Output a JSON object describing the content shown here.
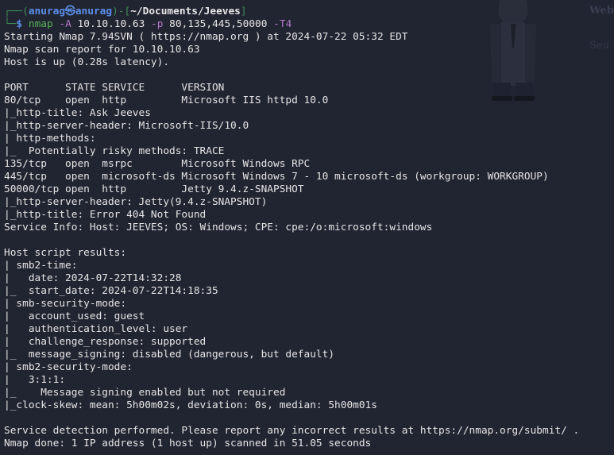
{
  "prompt": {
    "frame_top_left": "┌──(",
    "user_host": "anurag㉿anurag",
    "frame_mid": ")-[",
    "cwd": "~/Documents/Jeeves",
    "frame_end": "]",
    "frame_bottom": "└─",
    "dollar": "$"
  },
  "command": {
    "name": "nmap",
    "flag_A": "-A",
    "target": "10.10.10.63",
    "flag_p": "-p",
    "ports": "80,135,445,50000",
    "flag_T": "-T4"
  },
  "output_lines": [
    "Starting Nmap 7.94SVN ( https://nmap.org ) at 2024-07-22 05:32 EDT",
    "Nmap scan report for 10.10.10.63",
    "Host is up (0.28s latency).",
    "",
    "PORT      STATE SERVICE      VERSION",
    "80/tcp    open  http         Microsoft IIS httpd 10.0",
    "|_http-title: Ask Jeeves",
    "|_http-server-header: Microsoft-IIS/10.0",
    "| http-methods:",
    "|_  Potentially risky methods: TRACE",
    "135/tcp   open  msrpc        Microsoft Windows RPC",
    "445/tcp   open  microsoft-ds Microsoft Windows 7 - 10 microsoft-ds (workgroup: WORKGROUP)",
    "50000/tcp open  http         Jetty 9.4.z-SNAPSHOT",
    "|_http-server-header: Jetty(9.4.z-SNAPSHOT)",
    "|_http-title: Error 404 Not Found",
    "Service Info: Host: JEEVES; OS: Windows; CPE: cpe:/o:microsoft:windows",
    "",
    "Host script results:",
    "| smb2-time:",
    "|   date: 2024-07-22T14:32:28",
    "|_  start_date: 2024-07-22T14:18:35",
    "| smb-security-mode:",
    "|   account_used: guest",
    "|   authentication_level: user",
    "|   challenge_response: supported",
    "|_  message_signing: disabled (dangerous, but default)",
    "| smb2-security-mode:",
    "|   3:1:1:",
    "|_    Message signing enabled but not required",
    "|_clock-skew: mean: 5h00m02s, deviation: 0s, median: 5h00m01s",
    "",
    "Service detection performed. Please report any incorrect results at https://nmap.org/submit/ .",
    "Nmap done: 1 IP address (1 host up) scanned in 51.05 seconds"
  ],
  "background_text": {
    "line1": "Web",
    "line2": "Seu"
  },
  "colors": {
    "terminal_bg": "#212431",
    "text": "#e6e6e6",
    "prompt_user": "#5b8fe8",
    "prompt_frame": "#3f8f57",
    "command": "#56b556",
    "flags": "#b679c8"
  }
}
